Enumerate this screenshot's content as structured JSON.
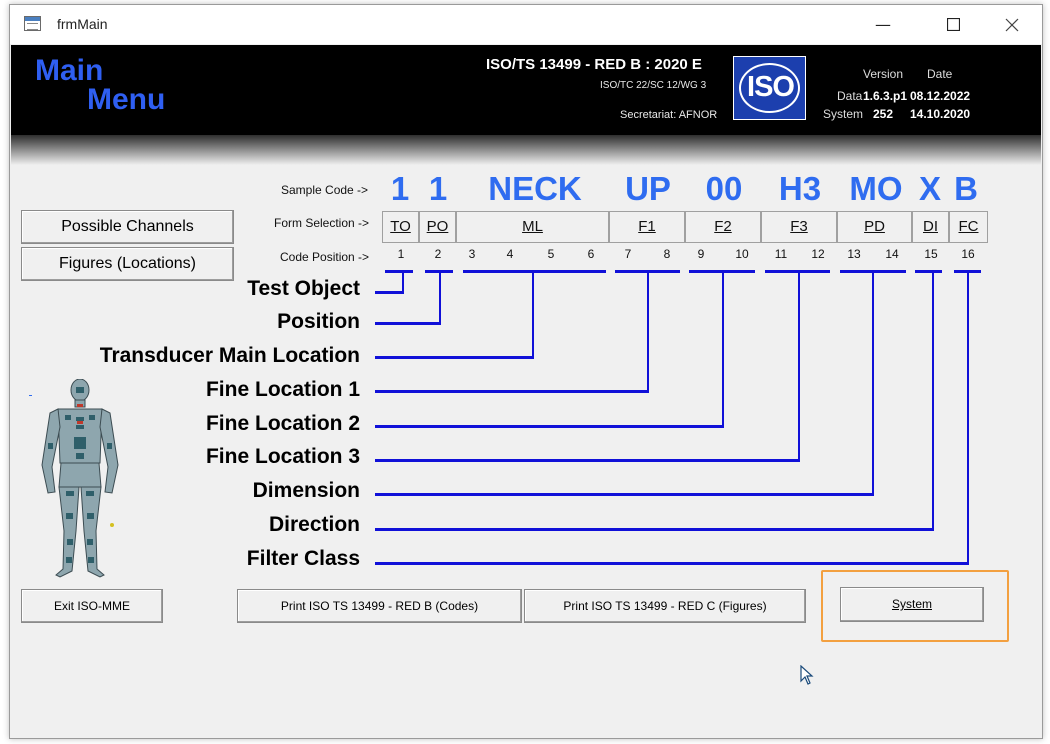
{
  "window": {
    "title": "frmMain",
    "minimize_icon": "minimize-icon",
    "maximize_icon": "maximize-icon",
    "close_icon": "close-icon"
  },
  "header": {
    "main_menu_line1": "Main",
    "main_menu_line2": "Menu",
    "standard_title": "ISO/TS 13499 - RED B : 2020 E",
    "committee": "ISO/TC 22/SC 12/WG 3",
    "secretariat": "Secretariat: AFNOR",
    "logo_text": "ISO",
    "version_header": "Version",
    "date_header": "Date",
    "data_label": "Data",
    "data_version": "1.6.3.p1",
    "data_date": "08.12.2022",
    "system_label": "System",
    "system_version": "252",
    "system_date": "14.10.2020"
  },
  "labels": {
    "sample_code": "Sample Code ->",
    "form_selection": "Form Selection ->",
    "code_position": "Code Position ->"
  },
  "sample_code": [
    "1",
    "1",
    "NECK",
    "UP",
    "00",
    "H3",
    "MO",
    "X",
    "B"
  ],
  "form_selection": [
    "TO",
    "PO",
    "ML",
    "F1",
    "F2",
    "F3",
    "PD",
    "DI",
    "FC"
  ],
  "code_positions": [
    "1",
    "2",
    "3",
    "4",
    "5",
    "6",
    "7",
    "8",
    "9",
    "10",
    "11",
    "12",
    "13",
    "14",
    "15",
    "16"
  ],
  "fields": [
    "Test Object",
    "Position",
    "Transducer Main Location",
    "Fine Location 1",
    "Fine Location 2",
    "Fine Location 3",
    "Dimension",
    "Direction",
    "Filter Class"
  ],
  "buttons": {
    "possible_channels": "Possible Channels",
    "figures": "Figures (Locations)",
    "exit": "Exit ISO-MME",
    "print_codes": "Print ISO TS 13499 - RED B (Codes)",
    "print_figures": "Print ISO TS 13499 - RED C (Figures)",
    "system": "System"
  },
  "colors": {
    "accent_blue": "#2f6cf0",
    "line_blue": "#1010d8",
    "highlight_orange": "#f3a040",
    "header_black": "#000000"
  }
}
